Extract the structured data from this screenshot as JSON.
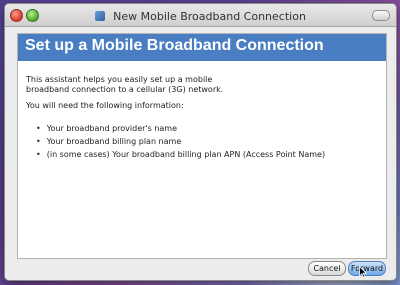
{
  "window": {
    "title": "New Mobile Broadband Connection"
  },
  "banner": {
    "title": "Set up a Mobile Broadband Connection"
  },
  "content": {
    "intro_line1": "This assistant helps you easily set up a mobile",
    "intro_line2": "broadband connection to a cellular (3G) network.",
    "needs": "You will need the following information:",
    "items": [
      "Your broadband provider's name",
      "Your broadband billing plan name",
      "(in some cases) Your broadband billing plan APN (Access Point Name)"
    ]
  },
  "buttons": {
    "cancel": "Cancel",
    "forward": "Forward"
  },
  "icons": {
    "close": "close-icon",
    "maximize": "maximize-icon",
    "title": "network-icon",
    "cursor": "pointer-cursor-icon"
  },
  "colors": {
    "banner": "#4a7ec3",
    "window_bg": "#ececec"
  }
}
